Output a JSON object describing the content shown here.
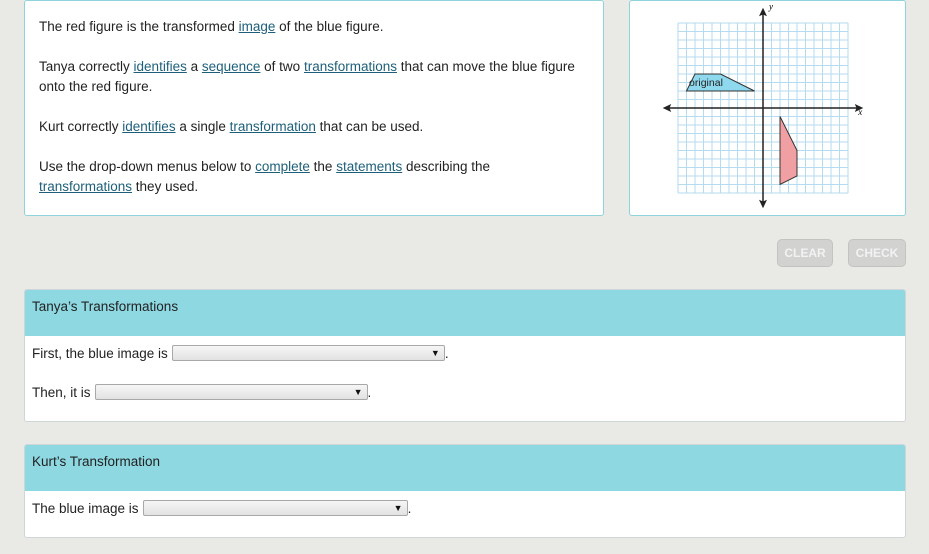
{
  "prompt": {
    "paragraphs": [
      [
        {
          "t": "The red figure is the transformed "
        },
        {
          "t": "image",
          "link": true
        },
        {
          "t": " of the blue figure."
        }
      ],
      [
        {
          "t": "Tanya correctly "
        },
        {
          "t": "identifies",
          "link": true
        },
        {
          "t": " a "
        },
        {
          "t": "sequence",
          "link": true
        },
        {
          "t": " of two "
        },
        {
          "t": "transformations",
          "link": true
        },
        {
          "t": " that can move the blue figure onto the red figure."
        }
      ],
      [
        {
          "t": "Kurt correctly "
        },
        {
          "t": "identifies",
          "link": true
        },
        {
          "t": " a single "
        },
        {
          "t": "transformation",
          "link": true
        },
        {
          "t": " that can be used."
        }
      ],
      [
        {
          "t": "Use the drop-down menus below to "
        },
        {
          "t": "complete",
          "link": true
        },
        {
          "t": " the "
        },
        {
          "t": "statements",
          "link": true
        },
        {
          "t": " describing the "
        },
        {
          "t": "transformations",
          "link": true
        },
        {
          "t": " they used."
        }
      ]
    ]
  },
  "graph": {
    "x_label": "x",
    "y_label": "y",
    "range": [
      -10,
      10
    ],
    "blue_label": "original",
    "blue_color": "#8fd9ef",
    "blue_points": [
      [
        -9,
        2
      ],
      [
        -8,
        4
      ],
      [
        -5,
        4
      ],
      [
        -1,
        2
      ]
    ],
    "red_color": "#f0a0a3",
    "red_points": [
      [
        2,
        -1
      ],
      [
        4,
        -5
      ],
      [
        4,
        -8
      ],
      [
        2,
        -9
      ]
    ]
  },
  "buttons": {
    "clear": "CLEAR",
    "check": "CHECK"
  },
  "tanya": {
    "title": "Tanya’s Transformations",
    "first_label": "First, the blue image is",
    "first_value": "",
    "then_label": "Then, it is",
    "then_value": "",
    "period": "."
  },
  "kurt": {
    "title": "Kurt’s Transformation",
    "label": "The blue image is",
    "value": "",
    "period": "."
  }
}
